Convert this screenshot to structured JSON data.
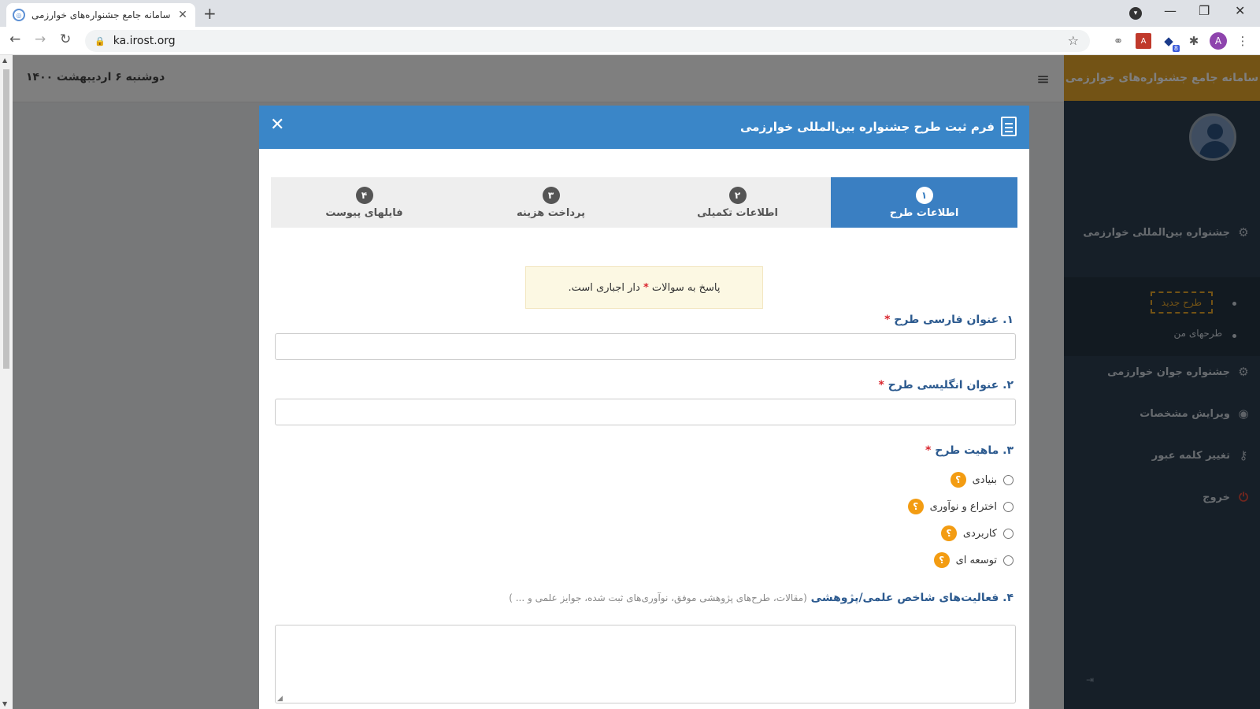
{
  "browser": {
    "tab_title": "سامانه جامع جشنواره‌های خوارزمی",
    "url": "ka.irost.org",
    "extension_badge": "8",
    "profile_initial": "A"
  },
  "topbar": {
    "date": "دوشنبه ۶ اردیبهشت ۱۴۰۰"
  },
  "sidebar": {
    "brand": "سامانه جامع جشنواره‌های خوارزمی",
    "items": [
      {
        "label": "جشنواره بین‌المللی خوارزمی",
        "icon": "gears-icon"
      },
      {
        "label": "جشنواره جوان خوارزمی",
        "icon": "gears-icon"
      },
      {
        "label": "ویرایش مشخصات",
        "icon": "user-circle-icon"
      },
      {
        "label": "تغییر کلمه عبور",
        "icon": "key-icon"
      },
      {
        "label": "خروج",
        "icon": "power-icon"
      }
    ],
    "sub_items": [
      "طرح جدید",
      "طرحهای من"
    ],
    "accent": "#e7a62b"
  },
  "modal": {
    "title": "فرم ثبت طرح جشنواره بین‌المللی خوارزمی",
    "header_color": "#3a86c8",
    "steps": [
      {
        "num": "۱",
        "label": "اطلاعات طرح"
      },
      {
        "num": "۲",
        "label": "اطلاعات تکمیلی"
      },
      {
        "num": "۳",
        "label": "پرداخت هزینه"
      },
      {
        "num": "۴",
        "label": "فایلهای پیوست"
      }
    ],
    "notice_before": "پاسخ به سوالات",
    "notice_after": "دار اجباری است.",
    "star": "*",
    "q1": "۱. عنوان فارسی طرح",
    "q2": "۲. عنوان انگلیسی طرح",
    "q3": "۳. ماهیت طرح",
    "q3_options": [
      "بنیادی",
      "اختراع و نوآوری",
      "کاربردی",
      "توسعه ای"
    ],
    "help_glyph": "؟",
    "q4": "۴. فعالیت‌های شاخص علمی/پژوهشی",
    "q4_hint": "(مقالات، طرح‌های پژوهشی موفق، نوآوری‌های ثبت شده، جوایز علمی و ... )"
  }
}
